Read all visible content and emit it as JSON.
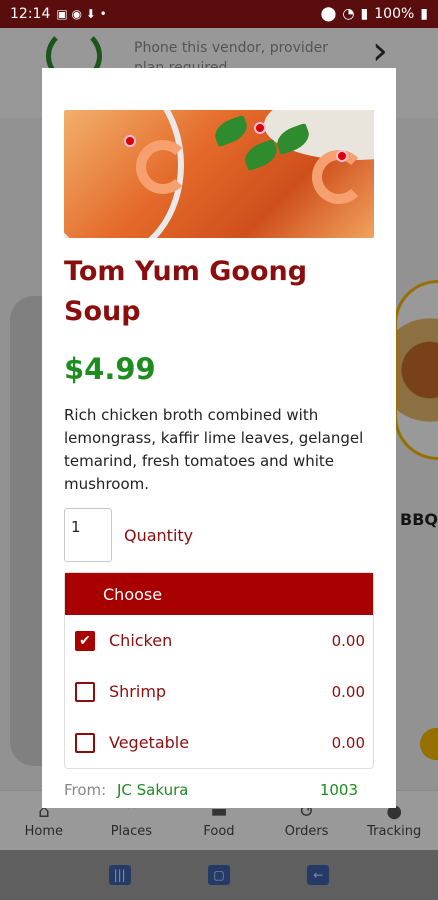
{
  "status_bar": {
    "time": "12:14",
    "battery": "100%"
  },
  "background": {
    "vendor_text": "Phone this vendor, provider plan required",
    "side_label": "BBQ"
  },
  "bottom_nav": {
    "items": [
      {
        "label": "Home",
        "icon": "home-icon"
      },
      {
        "label": "Places",
        "icon": "places-icon"
      },
      {
        "label": "Food",
        "icon": "food-icon"
      },
      {
        "label": "Orders",
        "icon": "orders-icon"
      },
      {
        "label": "Tracking",
        "icon": "tracking-icon"
      }
    ]
  },
  "modal": {
    "title": "Tom Yum Goong Soup",
    "price": "$4.99",
    "description": "Rich chicken broth combined with lemongrass, kaffir lime leaves, gelangel temarind, fresh tomatoes and white mushroom.",
    "quantity": {
      "value": "1",
      "label": "Quantity"
    },
    "options_header": "Choose",
    "options": [
      {
        "name": "Chicken",
        "price": "0.00",
        "checked": true
      },
      {
        "name": "Shrimp",
        "price": "0.00",
        "checked": false
      },
      {
        "name": "Vegetable",
        "price": "0.00",
        "checked": false
      }
    ],
    "from": {
      "label": "From:",
      "vendor": "JC Sakura",
      "code": "1003"
    }
  },
  "colors": {
    "brand": "#8b0e0e",
    "header": "#a80000",
    "price": "#1e8c1e"
  }
}
